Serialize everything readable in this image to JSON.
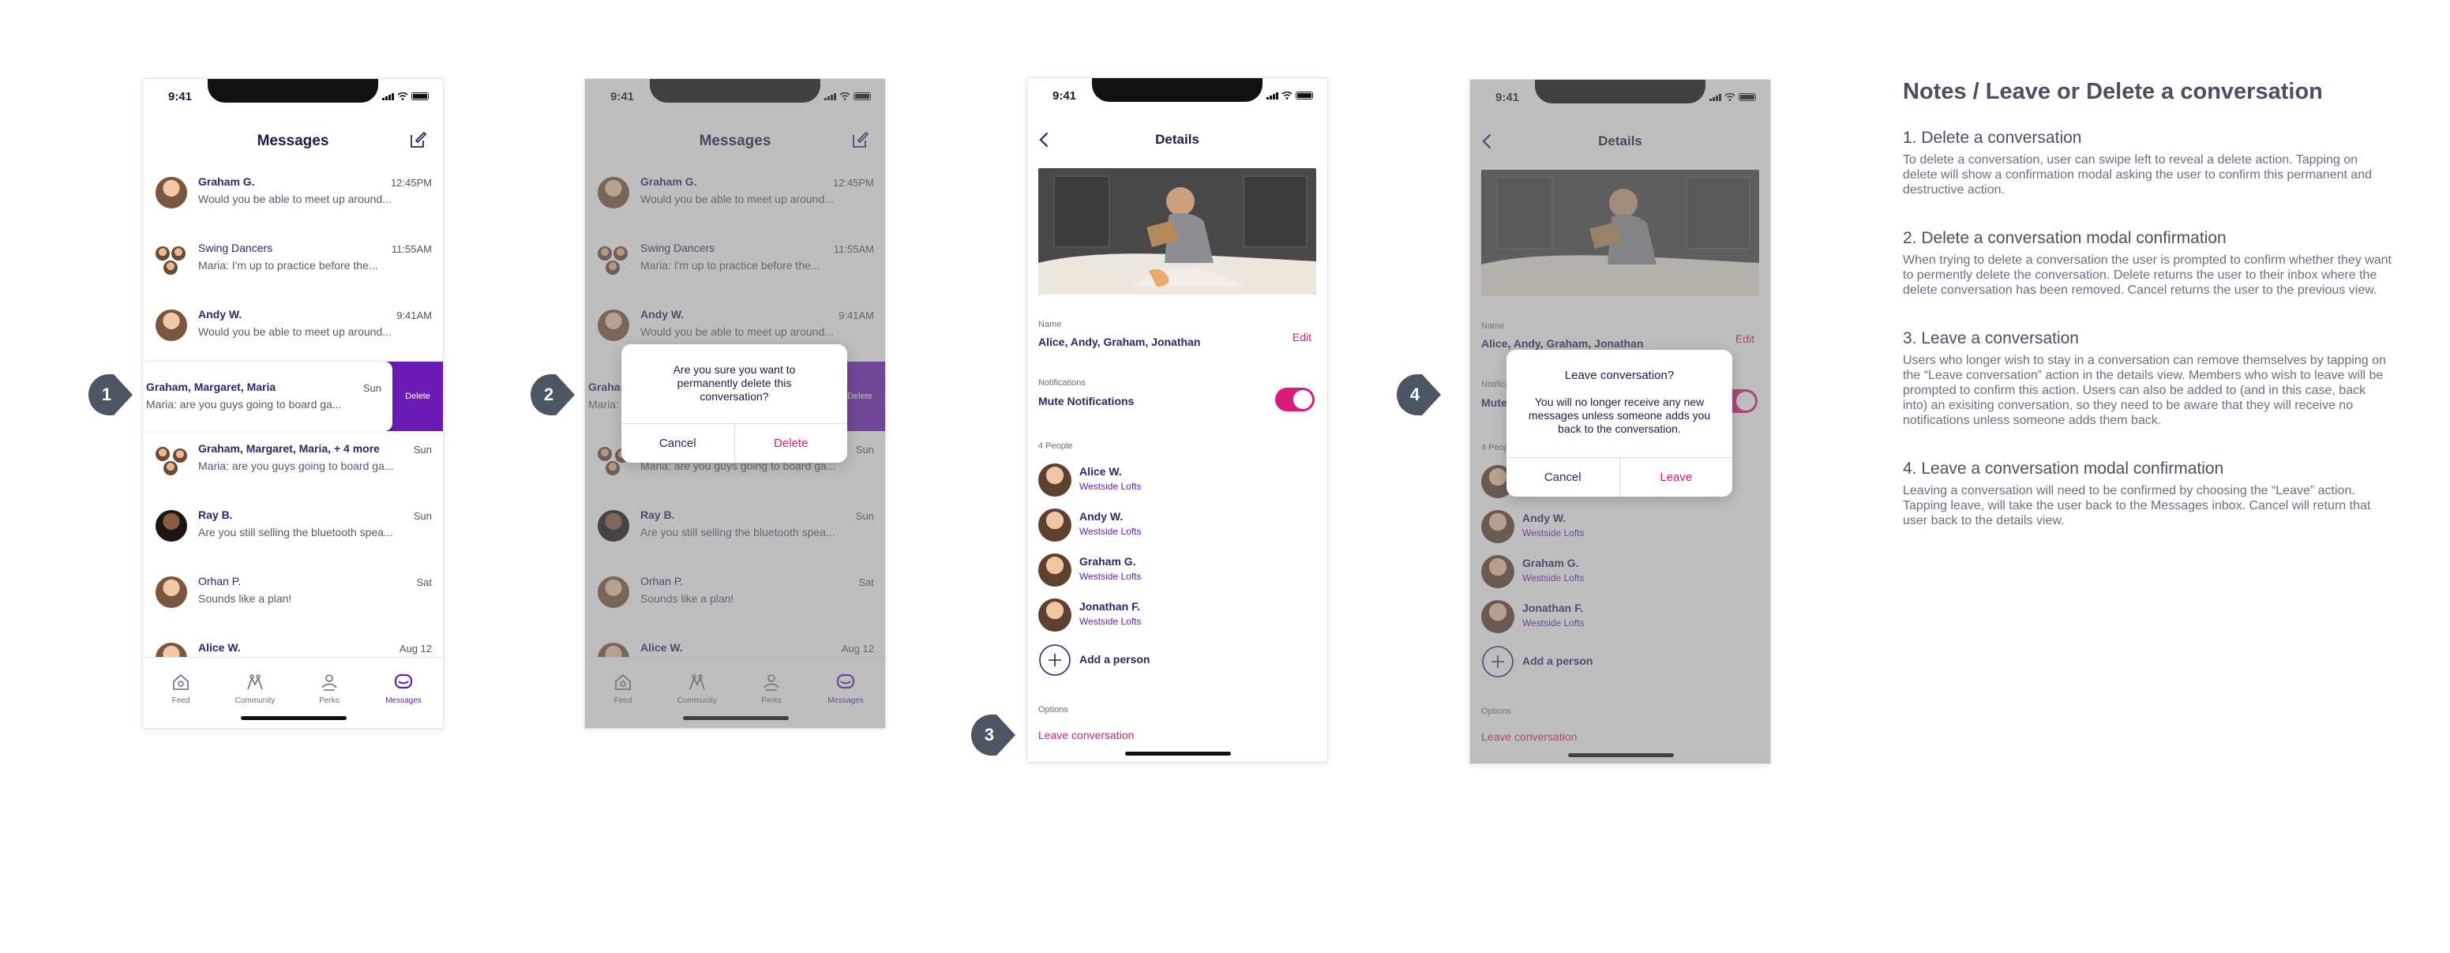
{
  "status_time": "9:41",
  "inbox": {
    "title": "Messages",
    "messages": [
      {
        "name": "Graham G.",
        "preview": "Would you be able to meet up around...",
        "time": "12:45PM"
      },
      {
        "name": "Swing Dancers",
        "preview": "Maria: I'm up to practice before the...",
        "time": "11:55AM"
      },
      {
        "name": "Andy W.",
        "preview": "Would you be able to meet up around...",
        "time": "9:41AM"
      },
      {
        "name": "Graham, Margaret, Maria",
        "preview": "Maria: are you guys going to board ga...",
        "time": "Sun"
      },
      {
        "name": "Graham, Margaret, Maria, + 4 more",
        "preview": "Maria: are you guys going to board ga...",
        "time": "Sun"
      },
      {
        "name": "Ray B.",
        "preview": "Are you still selling the bluetooth spea...",
        "time": "Sun"
      },
      {
        "name": "Orhan P.",
        "preview": "Sounds like a plan!",
        "time": "Sat"
      },
      {
        "name": "Alice W.",
        "preview": "",
        "time": "Aug 12"
      }
    ],
    "delete_label": "Delete",
    "tabs": [
      {
        "label": "Feed",
        "icon": "home-icon"
      },
      {
        "label": "Community",
        "icon": "community-icon"
      },
      {
        "label": "Perks",
        "icon": "perks-icon"
      },
      {
        "label": "Messages",
        "icon": "messages-icon"
      }
    ]
  },
  "delete_modal": {
    "text": "Are you sure you want to permanently delete this conversation?",
    "cancel": "Cancel",
    "confirm": "Delete"
  },
  "details": {
    "title": "Details",
    "name_label": "Name",
    "name_value": "Alice, Andy, Graham, Jonathan",
    "edit": "Edit",
    "notifications_label": "Notifications",
    "mute_label": "Mute Notifications",
    "mute_on": true,
    "people_label": "4 People",
    "people": [
      {
        "name": "Alice W.",
        "location": "Westside Lofts"
      },
      {
        "name": "Andy W.",
        "location": "Westside Lofts"
      },
      {
        "name": "Graham G.",
        "location": "Westside Lofts"
      },
      {
        "name": "Jonathan F.",
        "location": "Westside Lofts"
      }
    ],
    "add_person": "Add a person",
    "options_label": "Options",
    "leave": "Leave conversation"
  },
  "leave_modal": {
    "title": "Leave conversation?",
    "text": "You will no longer receive any new messages unless someone adds you back to the conversation.",
    "cancel": "Cancel",
    "confirm": "Leave"
  },
  "markers": [
    "1",
    "2",
    "3",
    "4"
  ],
  "notes": {
    "title": "Notes / Leave or Delete a conversation",
    "sections": [
      {
        "heading": "1. Delete a conversation",
        "body": "To delete a conversation, user can swipe left to reveal a delete action. Tapping on delete will show a confirmation modal asking the user to confirm this permanent and destructive action."
      },
      {
        "heading": "2. Delete a conversation modal confirmation",
        "body": "When trying to delete a conversation the user is prompted to confirm whether they want to permently delete the conversation. Delete returns the user to their inbox where the delete conversation has been removed. Cancel returns the user to the previous view."
      },
      {
        "heading": "3. Leave a conversation",
        "body": "Users who longer wish to stay in a conversation can remove themselves by tapping on the “Leave conversation” action in the details view. Members who wish to leave will be prompted to confirm this action. Users can also be added to (and in this case, back into) an exisiting conversation, so they need to be aware that they will receive no notifications unless someone adds them back."
      },
      {
        "heading": "4. Leave a conversation modal confirmation",
        "body": "Leaving a conversation will need to be confirmed by choosing the “Leave” action. Tapping leave, will take the user back to the Messages inbox. Cancel will return that user back to the details view."
      }
    ]
  },
  "colors": {
    "accent": "#6a1bb4",
    "pink": "#d81b7a",
    "navy": "#2a2866",
    "marker": "#4b5563"
  }
}
